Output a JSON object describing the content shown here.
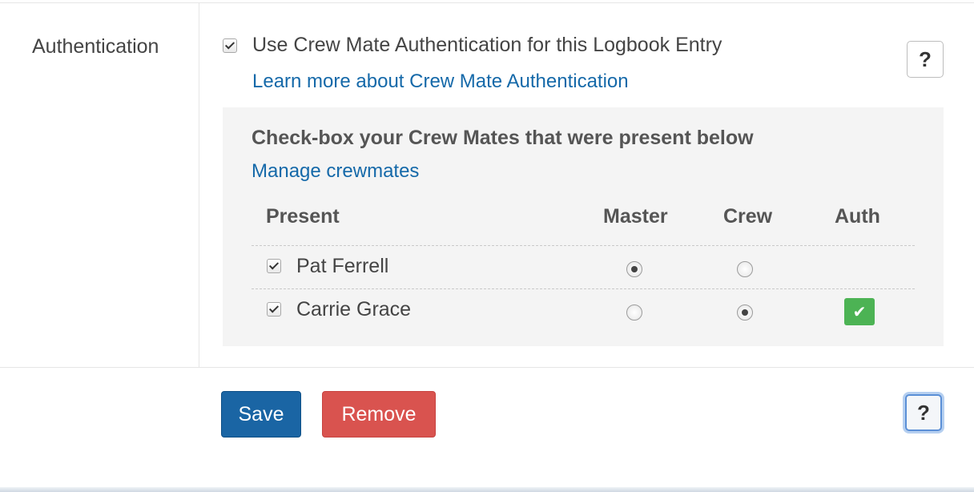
{
  "form": {
    "row_label": "Authentication",
    "use_auth_checked": true,
    "use_auth_label": "Use Crew Mate Authentication for this Logbook Entry",
    "learn_more_link": "Learn more about Crew Mate Authentication",
    "help_label": "?"
  },
  "crew_panel": {
    "heading": "Check-box your Crew Mates that were present below",
    "manage_link": "Manage crewmates",
    "columns": [
      "Present",
      "Master",
      "Crew",
      "Auth"
    ],
    "rows": [
      {
        "name": "Pat Ferrell",
        "present": true,
        "role": "Master",
        "auth_icon": ""
      },
      {
        "name": "Carrie Grace",
        "present": true,
        "role": "Crew",
        "auth_icon": "check-icon"
      }
    ]
  },
  "actions": {
    "save_label": "Save",
    "remove_label": "Remove",
    "help_label": "?"
  },
  "colors": {
    "link": "#1569a9",
    "save": "#1a65a4",
    "remove": "#d9534f",
    "auth_ok": "#4cb354"
  }
}
